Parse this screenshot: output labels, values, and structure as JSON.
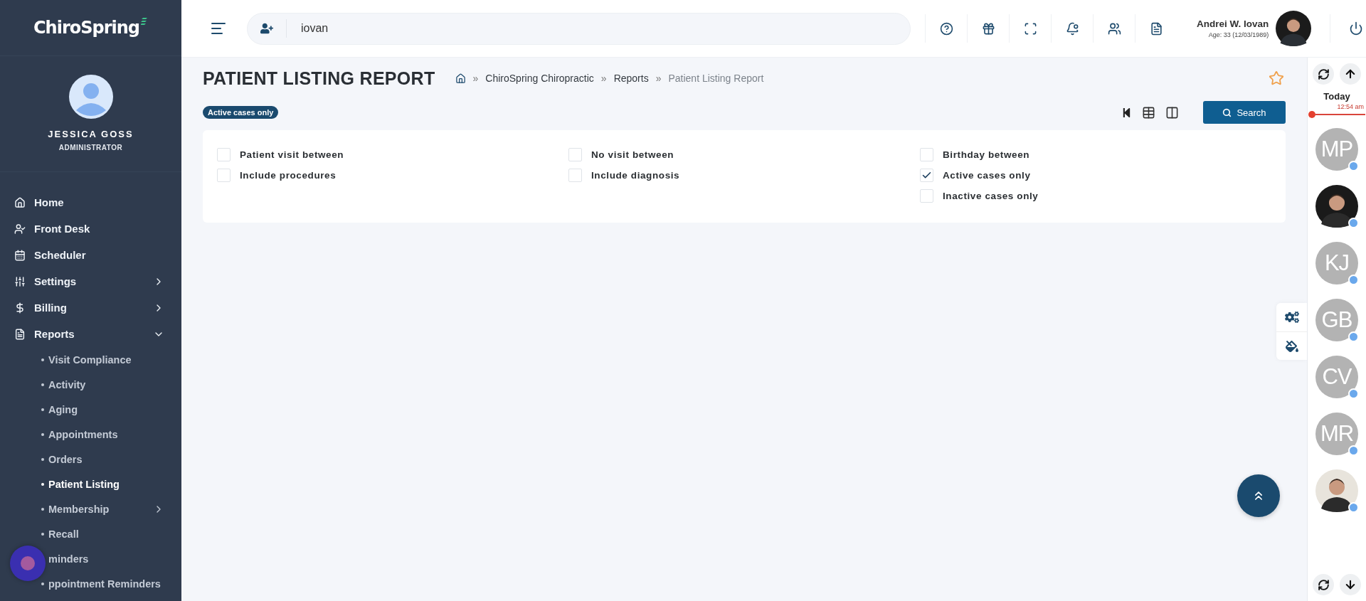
{
  "brand": {
    "name": "ChiroSpring"
  },
  "user": {
    "name": "JESSICA GOSS",
    "role": "ADMINISTRATOR"
  },
  "nav": [
    {
      "label": "Home"
    },
    {
      "label": "Front Desk"
    },
    {
      "label": "Scheduler"
    },
    {
      "label": "Settings",
      "expanded": false
    },
    {
      "label": "Billing",
      "expanded": false
    },
    {
      "label": "Reports",
      "expanded": true,
      "children": [
        {
          "label": "Visit Compliance",
          "selected": false
        },
        {
          "label": "Activity",
          "selected": false
        },
        {
          "label": "Aging",
          "selected": false
        },
        {
          "label": "Appointments",
          "selected": false
        },
        {
          "label": "Orders",
          "selected": false
        },
        {
          "label": "Patient Listing",
          "selected": true
        },
        {
          "label": "Membership",
          "selected": false,
          "expanded": false
        },
        {
          "label": "Recall",
          "selected": false
        },
        {
          "label": "minders",
          "selected": false
        },
        {
          "label": "ppointment Reminders",
          "selected": false
        }
      ]
    }
  ],
  "topbar": {
    "search": {
      "value": "iovan"
    },
    "patient": {
      "name": "Andrei W. Iovan",
      "details": "Age: 33 (12/03/1989)"
    }
  },
  "page": {
    "title": "PATIENT LISTING REPORT",
    "breadcrumb": [
      "ChiroSpring Chiropractic",
      "Reports",
      "Patient Listing Report"
    ],
    "separator": "»",
    "favorite": false,
    "filter_tags": [
      "Active cases only"
    ],
    "search_button": "Search"
  },
  "filters": [
    [
      {
        "label": "Patient visit between",
        "checked": false
      },
      {
        "label": "Include procedures",
        "checked": false
      }
    ],
    [
      {
        "label": "No visit between",
        "checked": false
      },
      {
        "label": "Include diagnosis",
        "checked": false
      }
    ],
    [
      {
        "label": "Birthday between",
        "checked": false
      },
      {
        "label": "Active cases only",
        "checked": true
      },
      {
        "label": "Inactive cases only",
        "checked": false
      }
    ]
  ],
  "schedule": {
    "day": "Today",
    "time": "12:54 am",
    "providers": [
      {
        "kind": "initials",
        "initials": "MP"
      },
      {
        "kind": "picture"
      },
      {
        "kind": "initials",
        "initials": "KJ"
      },
      {
        "kind": "initials",
        "initials": "GB"
      },
      {
        "kind": "initials",
        "initials": "CV"
      },
      {
        "kind": "initials",
        "initials": "MR"
      },
      {
        "kind": "picture"
      }
    ]
  }
}
